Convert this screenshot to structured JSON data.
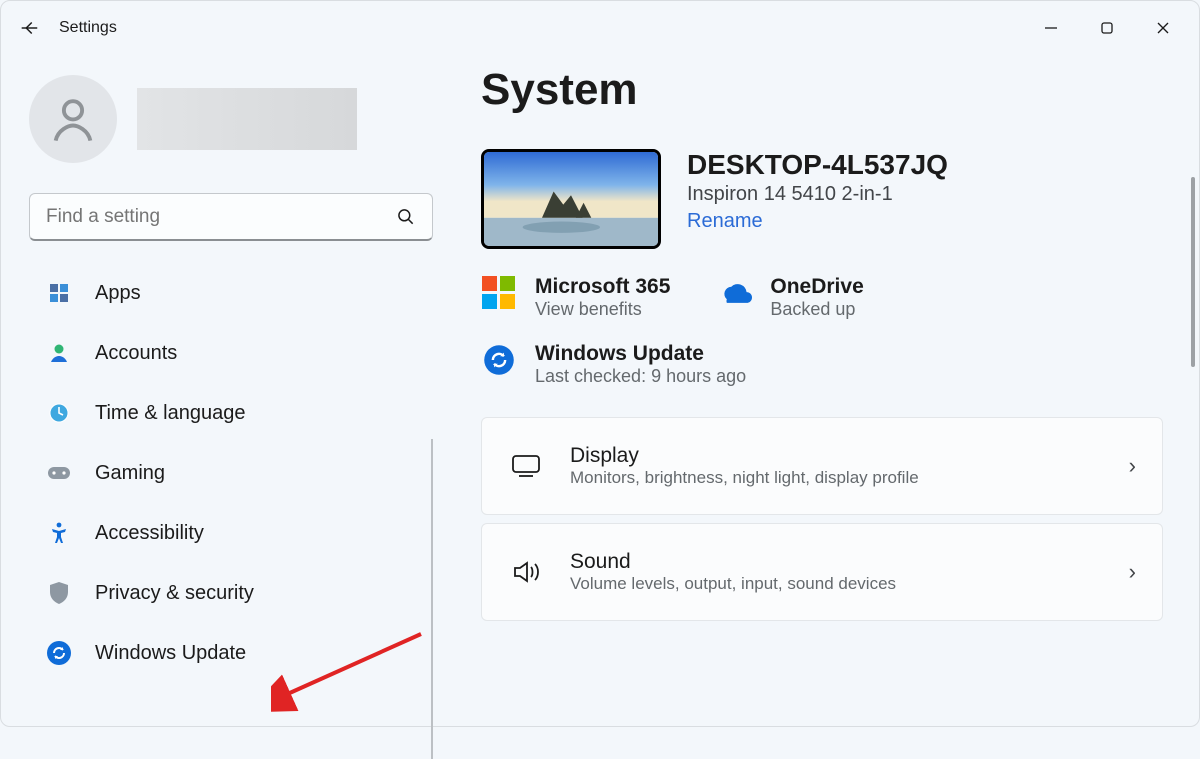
{
  "titlebar": {
    "app_title": "Settings"
  },
  "sidebar": {
    "search_placeholder": "Find a setting",
    "items": [
      {
        "label": "Apps"
      },
      {
        "label": "Accounts"
      },
      {
        "label": "Time & language"
      },
      {
        "label": "Gaming"
      },
      {
        "label": "Accessibility"
      },
      {
        "label": "Privacy & security"
      },
      {
        "label": "Windows Update"
      }
    ]
  },
  "main": {
    "heading": "System",
    "device": {
      "name": "DESKTOP-4L537JQ",
      "model": "Inspiron 14 5410 2-in-1",
      "rename_label": "Rename"
    },
    "services": {
      "m365": {
        "title": "Microsoft 365",
        "sub": "View benefits"
      },
      "onedrive": {
        "title": "OneDrive",
        "sub": "Backed up"
      },
      "update": {
        "title": "Windows Update",
        "sub": "Last checked: 9 hours ago"
      }
    },
    "cards": [
      {
        "title": "Display",
        "sub": "Monitors, brightness, night light, display profile"
      },
      {
        "title": "Sound",
        "sub": "Volume levels, output, input, sound devices"
      }
    ]
  }
}
